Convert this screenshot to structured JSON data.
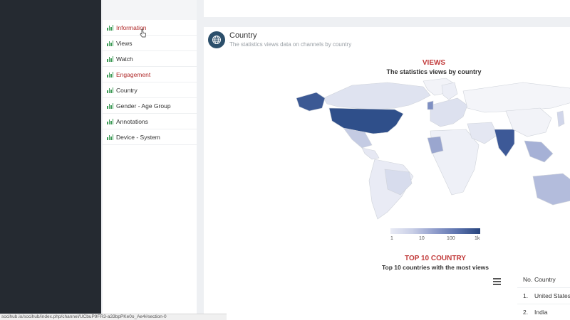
{
  "nav": {
    "items": [
      {
        "label": "Information",
        "state": "hovered"
      },
      {
        "label": "Views"
      },
      {
        "label": "Watch"
      },
      {
        "label": "Engagement",
        "state": "highlighted"
      },
      {
        "label": "Country"
      },
      {
        "label": "Gender - Age Group"
      },
      {
        "label": "Annotations"
      },
      {
        "label": "Device - System"
      }
    ]
  },
  "card": {
    "icon": "globe-icon",
    "title": "Country",
    "subtitle": "The statistics views data on channels by country"
  },
  "views_chart": {
    "title": "VIEWS",
    "subtitle": "The statistics views by country",
    "legend": {
      "labels": [
        "1",
        "10",
        "100",
        "1k"
      ]
    }
  },
  "top10": {
    "title": "TOP 10 COUNTRY",
    "subtitle": "Top 10 countries with the most views",
    "menu_icon": "hamburger-menu-icon",
    "columns": [
      "No.",
      "Country"
    ],
    "rows": [
      {
        "no": "1.",
        "country": "United States"
      },
      {
        "no": "2.",
        "country": "India"
      }
    ]
  },
  "status_bar": {
    "url": "socihub.io/socihub/index.php/channel/UCbuP9FR3-a33bpPKe0o_Ae4#section-0"
  },
  "colors": {
    "sidebar_dark": "#252a31",
    "accent_red": "#c23b3b",
    "map_high": "#28457d",
    "map_low": "#e9ebf5",
    "icon_green": "#3d9a56"
  }
}
